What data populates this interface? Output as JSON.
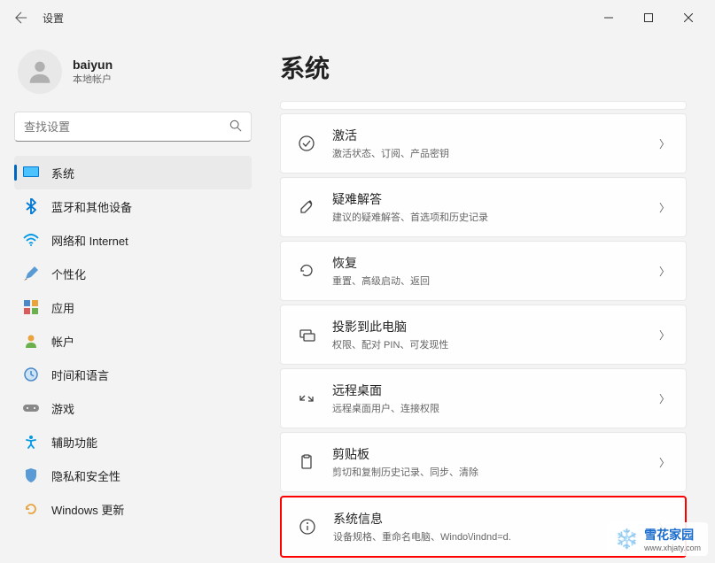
{
  "titlebar": {
    "title": "设置"
  },
  "user": {
    "name": "baiyun",
    "type": "本地帐户"
  },
  "search": {
    "placeholder": "查找设置"
  },
  "nav": {
    "items": [
      {
        "label": "系统",
        "icon": "system",
        "active": true
      },
      {
        "label": "蓝牙和其他设备",
        "icon": "bluetooth"
      },
      {
        "label": "网络和 Internet",
        "icon": "network"
      },
      {
        "label": "个性化",
        "icon": "personalize"
      },
      {
        "label": "应用",
        "icon": "apps"
      },
      {
        "label": "帐户",
        "icon": "account"
      },
      {
        "label": "时间和语言",
        "icon": "time"
      },
      {
        "label": "游戏",
        "icon": "gaming"
      },
      {
        "label": "辅助功能",
        "icon": "accessibility"
      },
      {
        "label": "隐私和安全性",
        "icon": "privacy"
      },
      {
        "label": "Windows 更新",
        "icon": "update"
      }
    ]
  },
  "main": {
    "title": "系统",
    "settings": [
      {
        "title": "激活",
        "desc": "激活状态、订阅、产品密钥",
        "icon": "activate"
      },
      {
        "title": "疑难解答",
        "desc": "建议的疑难解答、首选项和历史记录",
        "icon": "troubleshoot"
      },
      {
        "title": "恢复",
        "desc": "重置、高级启动、返回",
        "icon": "recovery"
      },
      {
        "title": "投影到此电脑",
        "desc": "权限、配对 PIN、可发现性",
        "icon": "project"
      },
      {
        "title": "远程桌面",
        "desc": "远程桌面用户、连接权限",
        "icon": "remote"
      },
      {
        "title": "剪贴板",
        "desc": "剪切和复制历史记录、同步、清除",
        "icon": "clipboard"
      },
      {
        "title": "系统信息",
        "desc": "设备规格、重命名电脑、Windo\\/indnd=d.",
        "icon": "about",
        "highlighted": true
      }
    ]
  },
  "watermark": {
    "title": "雪花家园",
    "url": "www.xhjaty.com"
  }
}
